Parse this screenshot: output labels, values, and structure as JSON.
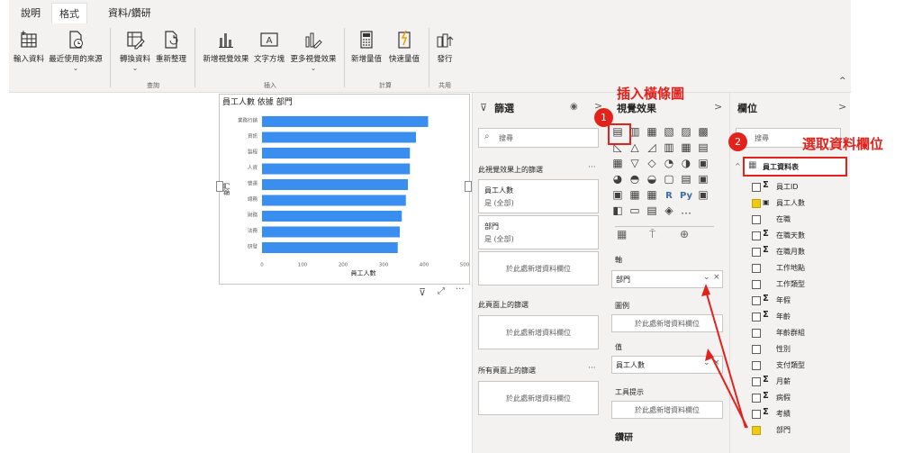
{
  "ribbon": {
    "tabs": [
      "說明",
      "格式",
      "資料/鑽研"
    ],
    "active_tab": "格式",
    "buttons": {
      "enter_data": "輸入資料",
      "recent_sources": "最近使用的來源",
      "transform": "轉換資料",
      "refresh": "重新整理",
      "new_visual": "新增視覺效果",
      "text_box": "文字方塊",
      "more_visuals": "更多視覺效果",
      "new_measure": "新增量值",
      "quick_measure": "快速量值",
      "publish": "發行"
    },
    "groups": {
      "query": "查詢",
      "insert": "插入",
      "calc": "計算",
      "share": "共用"
    }
  },
  "annotations": {
    "insert_bar": "插入橫條圖",
    "select_field": "選取資料欄位",
    "step1": "1",
    "step2": "2"
  },
  "chart_title": "員工人數 依據 部門",
  "chart_data": {
    "type": "bar",
    "orientation": "horizontal",
    "title": "員工人數 依據 部門",
    "xlabel": "員工人數",
    "ylabel": "部門",
    "categories": [
      "業務行銷",
      "資訊",
      "製程",
      "人資",
      "營運",
      "總務",
      "財務",
      "法務",
      "研發"
    ],
    "values": [
      410,
      380,
      365,
      365,
      360,
      355,
      345,
      340,
      335
    ],
    "xlim": [
      0,
      500
    ],
    "xticks": [
      "0",
      "100",
      "200",
      "300",
      "400",
      "500"
    ],
    "bar_color": "#3a8ef0"
  },
  "filters": {
    "title": "篩選",
    "search_placeholder": "搜尋",
    "visual_section": "此視覺效果上的篩選",
    "page_section": "此頁面上的篩選",
    "all_pages_section": "所有頁面上的篩選",
    "cards": [
      {
        "field": "員工人數",
        "value": "是 (全部)"
      },
      {
        "field": "部門",
        "value": "是 (全部)"
      }
    ],
    "add_field": "於此處新增資料欄位",
    "more": "···"
  },
  "visualizations": {
    "title": "視覺效果",
    "axis_label": "軸",
    "axis_value": "部門",
    "legend_label": "圖例",
    "legend_placeholder": "於此處新增資料欄位",
    "value_label": "值",
    "value_value": "員工人數",
    "tooltip_label": "工具提示",
    "tooltip_placeholder": "於此處新增資料欄位",
    "drill_label": "鑽研",
    "more": "···"
  },
  "fields": {
    "title": "欄位",
    "search_placeholder": "搜尋",
    "table": "員工資料表",
    "items": [
      {
        "name": "員工ID",
        "sigma": true,
        "checked": false
      },
      {
        "name": "員工人數",
        "sigma": false,
        "checked": true,
        "calc": true
      },
      {
        "name": "在職",
        "sigma": false,
        "checked": false
      },
      {
        "name": "在職天數",
        "sigma": true,
        "checked": false
      },
      {
        "name": "在職月數",
        "sigma": true,
        "checked": false
      },
      {
        "name": "工作地點",
        "sigma": false,
        "checked": false
      },
      {
        "name": "工作類型",
        "sigma": false,
        "checked": false
      },
      {
        "name": "年假",
        "sigma": true,
        "checked": false
      },
      {
        "name": "年齡",
        "sigma": true,
        "checked": false
      },
      {
        "name": "年齡群組",
        "sigma": false,
        "checked": false
      },
      {
        "name": "性別",
        "sigma": false,
        "checked": false
      },
      {
        "name": "支付類型",
        "sigma": false,
        "checked": false
      },
      {
        "name": "月薪",
        "sigma": true,
        "checked": false
      },
      {
        "name": "病假",
        "sigma": true,
        "checked": false
      },
      {
        "name": "考績",
        "sigma": true,
        "checked": false
      },
      {
        "name": "部門",
        "sigma": false,
        "checked": true
      }
    ]
  }
}
